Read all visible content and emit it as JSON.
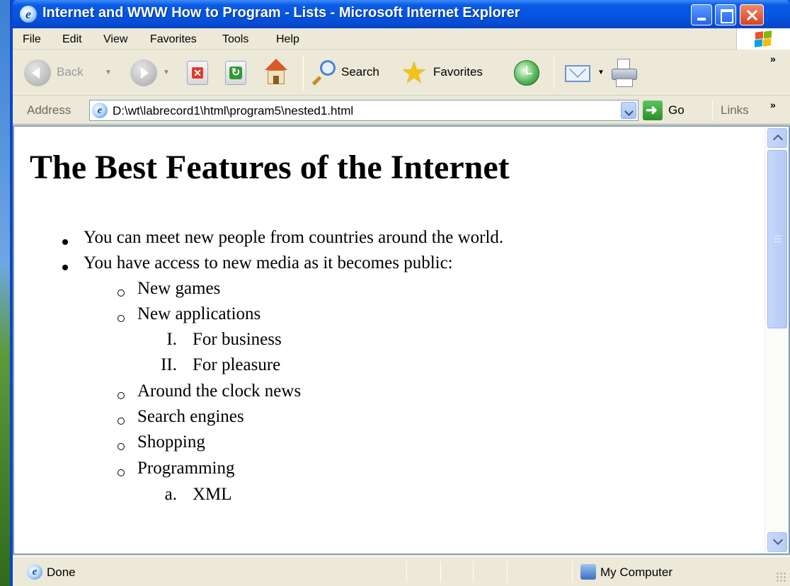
{
  "window": {
    "title": "Internet and WWW How to Program - Lists - Microsoft Internet Explorer",
    "icon_glyph": "e"
  },
  "menu": [
    "File",
    "Edit",
    "View",
    "Favorites",
    "Tools",
    "Help"
  ],
  "toolbar": {
    "back_label": "Back",
    "search_label": "Search",
    "favorites_label": "Favorites",
    "overflow_glyph": "»"
  },
  "address": {
    "label": "Address",
    "value": "D:\\wt\\labrecord1\\html\\program5\\nested1.html",
    "go_label": "Go",
    "links_label": "Links",
    "overflow_glyph": "»"
  },
  "page": {
    "heading": "The Best Features of the Internet",
    "items": {
      "item1": "You can meet new people from countries around the world.",
      "item2": "You have access to new media as it becomes public:",
      "sub1": "New games",
      "sub2": "New applications",
      "roman1_marker": "I.",
      "roman1": "For business",
      "roman2_marker": "II.",
      "roman2": "For pleasure",
      "sub3": "Around the clock news",
      "sub4": "Search engines",
      "sub5": "Shopping",
      "sub6": "Programming",
      "alpha1_marker": "a.",
      "alpha1": "XML"
    }
  },
  "status": {
    "text": "Done",
    "zone": "My Computer"
  },
  "colors": {
    "titlebar": "#0554e0",
    "chrome": "#ece9d8",
    "go_green": "#2a8e2a"
  }
}
